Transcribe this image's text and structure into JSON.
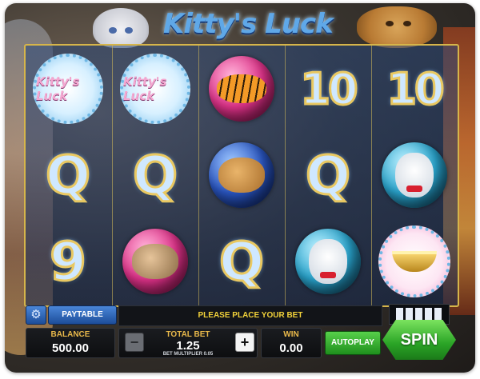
{
  "game": {
    "title": "Kitty's Luck"
  },
  "reels": [
    [
      "kittys-luck-logo",
      "Q",
      "9"
    ],
    [
      "kittys-luck-logo",
      "Q",
      "pink-kitten-orb"
    ],
    [
      "tiger-orb",
      "lion-cub-orb",
      "Q"
    ],
    [
      "10",
      "Q",
      "white-kitty-orb"
    ],
    [
      "10",
      "white-kitty-orb",
      "golden-bowl"
    ]
  ],
  "symbols": {
    "logo_text": "Kitty's Luck",
    "q": "Q",
    "nine": "9",
    "ten": "10"
  },
  "controls": {
    "paytable_label": "PAYTABLE",
    "message": "PLEASE PLACE YOUR BET",
    "balance_label": "BALANCE",
    "balance_value": "500.00",
    "total_bet_label": "TOTAL BET",
    "total_bet_value": "1.25",
    "bet_multiplier_text": "BET MULTIPLIER 0.05",
    "win_label": "WIN",
    "win_value": "0.00",
    "autoplay_label": "AUTOPLAY",
    "spin_label": "SPIN",
    "minus_symbol": "−",
    "plus_symbol": "+",
    "settings_icon": "gear-icon",
    "lines_icon": "paylines-grid-icon"
  },
  "colors": {
    "label_gold": "#e8b84a",
    "message_yellow": "#f2d23a",
    "spin_green": "#2aa426",
    "reel_border": "#d6b54a"
  }
}
